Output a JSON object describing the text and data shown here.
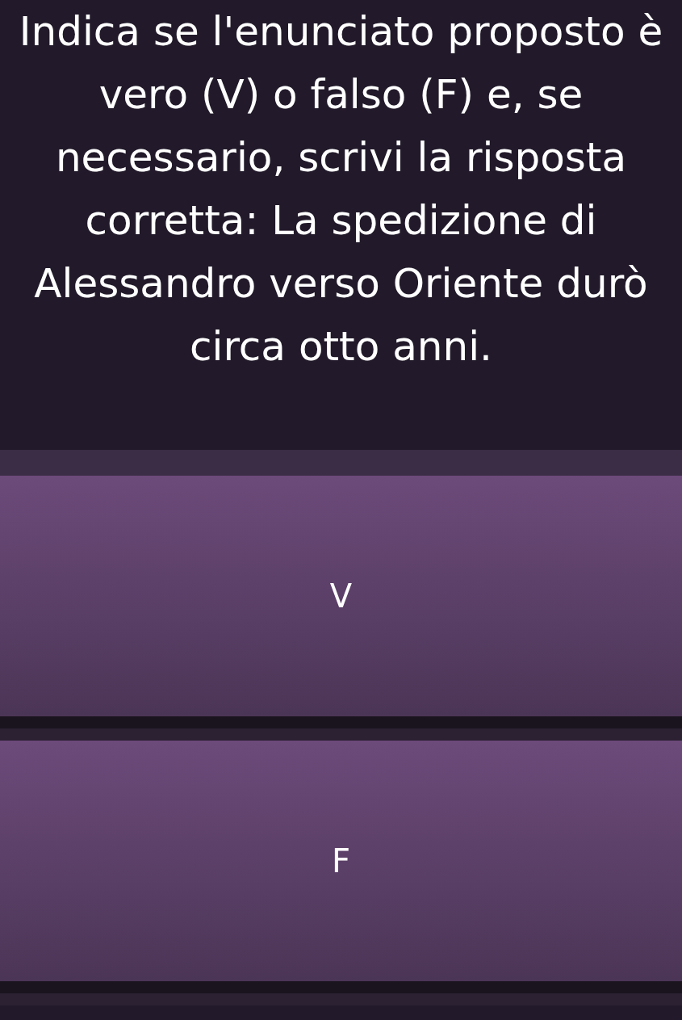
{
  "question": "Indica se l'enunciato proposto è vero (V) o falso (F) e, se necessario, scrivi la risposta corretta: La spedizione di Alessandro verso Oriente durò circa otto anni.",
  "options": [
    {
      "label": "V"
    },
    {
      "label": "F"
    }
  ]
}
